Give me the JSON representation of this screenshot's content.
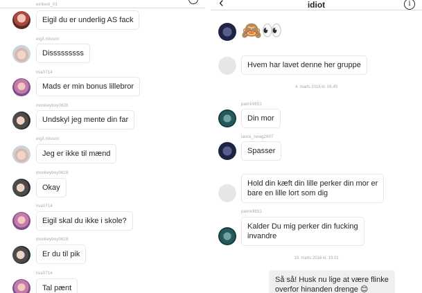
{
  "left_chat": {
    "top_username": "eirikeol_01",
    "messages": [
      {
        "username": "",
        "text": "Eigil du er underlig AS fack",
        "avatar": "pink"
      },
      {
        "username": "eigil.nilsson",
        "text": "Disssssssss",
        "avatar": "girl"
      },
      {
        "username": "liva0714",
        "text": "Mads er min bonus lillebror",
        "avatar": "purple"
      },
      {
        "username": "monkeyboy0628",
        "text": "Undskyl jeg mente din far",
        "avatar": "boy"
      },
      {
        "username": "eigil.nilsson",
        "text": "Jeg er ikke til mænd",
        "avatar": "girl"
      },
      {
        "username": "monkeyboy0628",
        "text": "Okay",
        "avatar": "boy"
      },
      {
        "username": "liva0714",
        "text": "Eigil skal du ikke i skole?",
        "avatar": "purple"
      },
      {
        "username": "monkeyboy0628",
        "text": "Er du til pik",
        "avatar": "boy"
      },
      {
        "username": "liva0714",
        "text": "Tal pænt",
        "avatar": "purple"
      }
    ]
  },
  "right_chat": {
    "title": "idiot",
    "back_icon": "chevron-left-icon",
    "info_icon": "info-icon",
    "emoji_message": "🙈👀",
    "messages": [
      {
        "username": "",
        "text": "Hvem har lavet denne her gruppe",
        "avatar": "grey"
      },
      {
        "timestamp": "4. marts 2016 kl. 06.45"
      },
      {
        "username": "patrik9851",
        "text": "Din mor",
        "avatar": "teal"
      },
      {
        "username": "laura_swag2607",
        "text": "Spasser",
        "avatar": "navy"
      },
      {
        "username": "",
        "text": "Hold din kæft din lille perker din mor er\nbare en lille lort som dig",
        "avatar": "grey"
      },
      {
        "username": "patrik9851",
        "text": "Kalder Du mig perker din fucking\ninvandre",
        "avatar": "teal"
      },
      {
        "timestamp": "19. marts 2016 kl. 19.01"
      },
      {
        "text": "Så så! Husk nu lige at være flinke\noverfor hinanden drenge 😊",
        "sent": true
      }
    ]
  }
}
